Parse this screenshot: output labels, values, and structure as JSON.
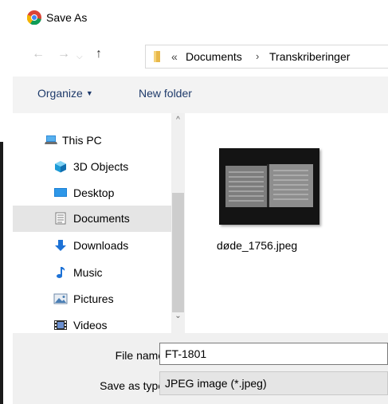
{
  "window": {
    "title": "Save As"
  },
  "nav": {
    "back_glyph": "←",
    "forward_glyph": "→",
    "recent_glyph": "⌵",
    "up_glyph": "↑",
    "breadcrumb_prefix": "«",
    "breadcrumbs": [
      "Documents",
      "Transkriberinger"
    ],
    "separator": "›"
  },
  "commands": {
    "organize": "Organize",
    "new_folder": "New folder"
  },
  "sidebar": {
    "items": [
      {
        "label": "This PC",
        "icon": "computer-icon"
      },
      {
        "label": "3D Objects",
        "icon": "cube-icon"
      },
      {
        "label": "Desktop",
        "icon": "desktop-icon"
      },
      {
        "label": "Documents",
        "icon": "document-icon",
        "selected": true
      },
      {
        "label": "Downloads",
        "icon": "download-arrow-icon"
      },
      {
        "label": "Music",
        "icon": "music-note-icon"
      },
      {
        "label": "Pictures",
        "icon": "picture-icon"
      },
      {
        "label": "Videos",
        "icon": "film-icon"
      }
    ]
  },
  "files": [
    {
      "name": "døde_1756.jpeg",
      "icon": "image-thumbnail"
    }
  ],
  "form": {
    "file_name_label": "File name:",
    "file_name_value": "FT-1801",
    "save_type_label": "Save as type:",
    "save_type_value": "JPEG image (*.jpeg)"
  },
  "colors": {
    "accent": "#1e3a6a",
    "selected_bg": "#e5e5e5",
    "footer_bg": "#f0f0f0",
    "cmdbar_bg": "#f3f3f3"
  }
}
